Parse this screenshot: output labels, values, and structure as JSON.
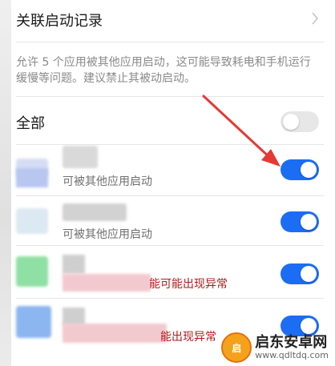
{
  "header": {
    "title": "关联启动记录",
    "chevron_icon": "chevron-right-icon"
  },
  "description": "允许 5 个应用被其他应用启动，这可能导致耗电和手机运行缓慢等问题。建议禁止其被动启动。",
  "all_row": {
    "label": "全部",
    "toggle_state": "off"
  },
  "apps": [
    {
      "subtitle": "可被其他应用启动",
      "toggle_state": "on"
    },
    {
      "subtitle": "可被其他应用启动",
      "toggle_state": "on"
    },
    {
      "warning": "能可能出现异常",
      "toggle_state": "on"
    },
    {
      "warning": "能出现异常",
      "toggle_state": "on"
    }
  ],
  "colors": {
    "toggle_on": "#1b6df4",
    "toggle_off": "#e7e7e7",
    "warning_text": "#b21a1a",
    "annotation_arrow": "#e53935"
  },
  "watermark": {
    "logo_text": "启",
    "name": "启东安卓网",
    "url": "www.qdltdq.com"
  }
}
